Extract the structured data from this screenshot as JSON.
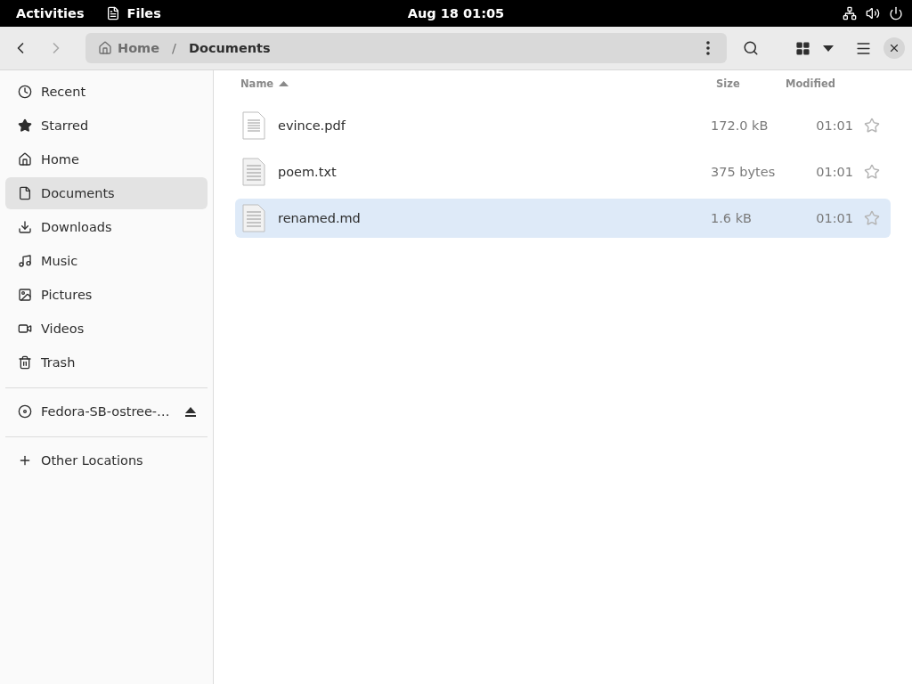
{
  "top_bar": {
    "activities": "Activities",
    "app_name": "Files",
    "clock": "Aug 18  01:05"
  },
  "header": {
    "back_disabled": false,
    "forward_disabled": true,
    "path": [
      {
        "label": "Home",
        "kind": "home"
      },
      {
        "label": "Documents",
        "kind": "folder"
      }
    ],
    "separator": "/"
  },
  "sidebar": {
    "places": [
      {
        "label": "Recent",
        "selected": false
      },
      {
        "label": "Starred",
        "selected": false
      },
      {
        "label": "Home",
        "selected": false
      },
      {
        "label": "Documents",
        "selected": true
      },
      {
        "label": "Downloads",
        "selected": false
      },
      {
        "label": "Music",
        "selected": false
      },
      {
        "label": "Pictures",
        "selected": false
      },
      {
        "label": "Videos",
        "selected": false
      },
      {
        "label": "Trash",
        "selected": false
      }
    ],
    "devices": [
      {
        "label": "Fedora-SB-ostree-…",
        "selected": false
      }
    ],
    "other": [
      {
        "label": "Other Locations",
        "selected": false
      }
    ]
  },
  "table": {
    "columns": [
      {
        "label": "Name",
        "sorted": true
      },
      {
        "label": "Size",
        "sorted": false
      },
      {
        "label": "Modified",
        "sorted": false
      }
    ],
    "rows": [
      {
        "name": "evince.pdf",
        "kind": "pdf",
        "size": "172.0 kB",
        "modified": "01:01",
        "starred": false,
        "selected": false
      },
      {
        "name": "poem.txt",
        "kind": "text",
        "size": "375 bytes",
        "modified": "01:01",
        "starred": false,
        "selected": false
      },
      {
        "name": "renamed.md",
        "kind": "text",
        "size": "1.6 kB",
        "modified": "01:01",
        "starred": false,
        "selected": true
      }
    ]
  }
}
